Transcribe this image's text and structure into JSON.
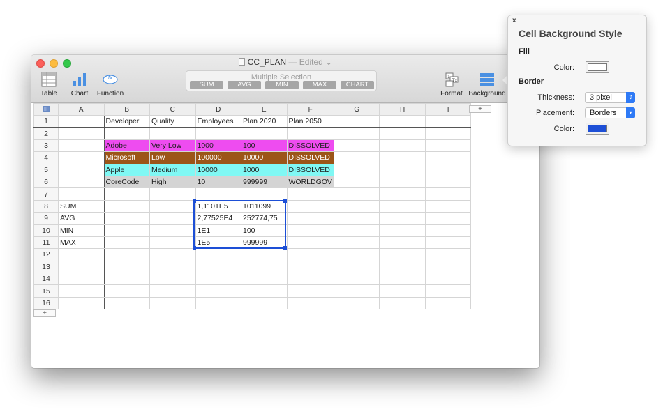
{
  "window": {
    "title": "CC_PLAN",
    "edited": " — Edited",
    "chevron": "⌄"
  },
  "toolbar": {
    "table_label": "Table",
    "chart_label": "Chart",
    "function_label": "Function",
    "function_glyph": "fx",
    "format_label": "Format",
    "background_label": "Background",
    "selection_label": "Multiple Selection",
    "function_buttons": [
      "SUM",
      "AVG",
      "MIN",
      "MAX",
      "CHART"
    ]
  },
  "sheet": {
    "columns": [
      "A",
      "B",
      "C",
      "D",
      "E",
      "F",
      "G",
      "H",
      "I"
    ],
    "add_column": "+",
    "add_row": "+",
    "rows": [
      [
        "1",
        "",
        "Developer",
        "Quality",
        "Employees",
        "Plan 2020",
        "Plan 2050",
        "",
        "",
        ""
      ],
      [
        "2",
        "",
        "",
        "",
        "",
        "",
        "",
        "",
        "",
        ""
      ],
      [
        "3",
        "",
        "Adobe",
        "Very Low",
        "1000",
        "100",
        "DISSOLVED",
        "",
        "",
        ""
      ],
      [
        "4",
        "",
        "Microsoft",
        "Low",
        "100000",
        "10000",
        "DISSOLVED",
        "",
        "",
        ""
      ],
      [
        "5",
        "",
        "Apple",
        "Medium",
        "10000",
        "1000",
        "DISSOLVED",
        "",
        "",
        ""
      ],
      [
        "6",
        "",
        "CoreCode",
        "High",
        "10",
        "999999",
        "WORLDGOV",
        "",
        "",
        ""
      ],
      [
        "7",
        "",
        "",
        "",
        "",
        "",
        "",
        "",
        "",
        ""
      ],
      [
        "8",
        "SUM",
        "",
        "",
        "1,1101E5",
        "1011099",
        "",
        "",
        "",
        ""
      ],
      [
        "9",
        "AVG",
        "",
        "",
        "2,77525E4",
        "252774,75",
        "",
        "",
        "",
        ""
      ],
      [
        "10",
        "MIN",
        "",
        "",
        "1E1",
        "100",
        "",
        "",
        "",
        ""
      ],
      [
        "11",
        "MAX",
        "",
        "",
        "1E5",
        "999999",
        "",
        "",
        "",
        ""
      ],
      [
        "12",
        "",
        "",
        "",
        "",
        "",
        "",
        "",
        "",
        ""
      ],
      [
        "13",
        "",
        "",
        "",
        "",
        "",
        "",
        "",
        "",
        ""
      ],
      [
        "14",
        "",
        "",
        "",
        "",
        "",
        "",
        "",
        "",
        ""
      ],
      [
        "15",
        "",
        "",
        "",
        "",
        "",
        "",
        "",
        "",
        ""
      ],
      [
        "16",
        "",
        "",
        "",
        "",
        "",
        "",
        "",
        "",
        ""
      ]
    ],
    "row_fills": [
      "",
      "",
      "#ee4cf0",
      "#9c5518",
      "#80f8f4",
      "#d4d4d4",
      "",
      "",
      "",
      "",
      "",
      "",
      "",
      "",
      "",
      ""
    ],
    "row_text_colors": [
      "",
      "",
      "#1e1e1e",
      "#ffffff",
      "#1e1e1e",
      "#1e1e1e",
      "",
      "",
      "",
      "",
      "",
      "",
      "",
      "",
      "",
      ""
    ],
    "selection_color": "#1d4fd6"
  },
  "popover": {
    "close": "x",
    "title": "Cell Background Style",
    "fill_header": "Fill",
    "fill_color_label": "Color:",
    "fill_color": "#ffffff",
    "border_header": "Border",
    "thickness_label": "Thickness:",
    "thickness_value": "3 pixel",
    "placement_label": "Placement:",
    "placement_value": "Borders",
    "border_color_label": "Color:",
    "border_color": "#1d4fd6"
  }
}
